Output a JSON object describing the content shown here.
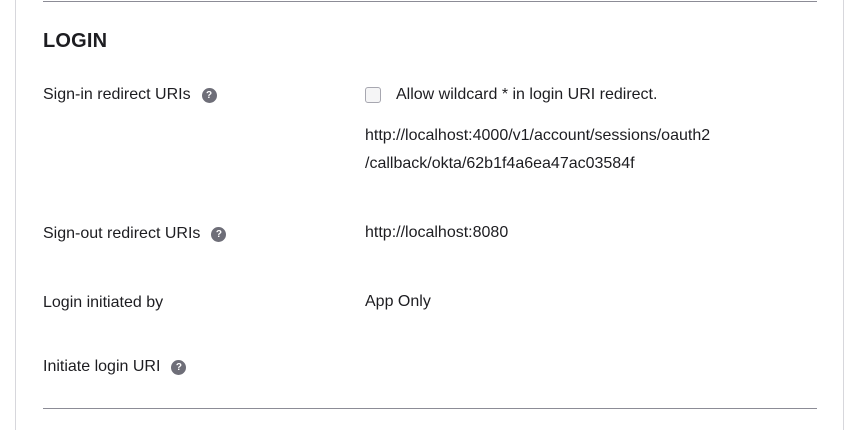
{
  "section": {
    "title": "LOGIN"
  },
  "rows": {
    "sign_in": {
      "label": "Sign-in redirect URIs",
      "wildcard_label": "Allow wildcard * in login URI redirect.",
      "wildcard_checked": false,
      "uri_line1": "http://localhost:4000/v1/account/sessions/oauth2",
      "uri_line2": "/callback/okta/62b1f4a6ea47ac03584f"
    },
    "sign_out": {
      "label": "Sign-out redirect URIs",
      "uri": "http://localhost:8080"
    },
    "login_initiated": {
      "label": "Login initiated by",
      "value": "App Only"
    },
    "initiate_uri": {
      "label": "Initiate login URI",
      "value": ""
    }
  },
  "icons": {
    "help": "?"
  }
}
